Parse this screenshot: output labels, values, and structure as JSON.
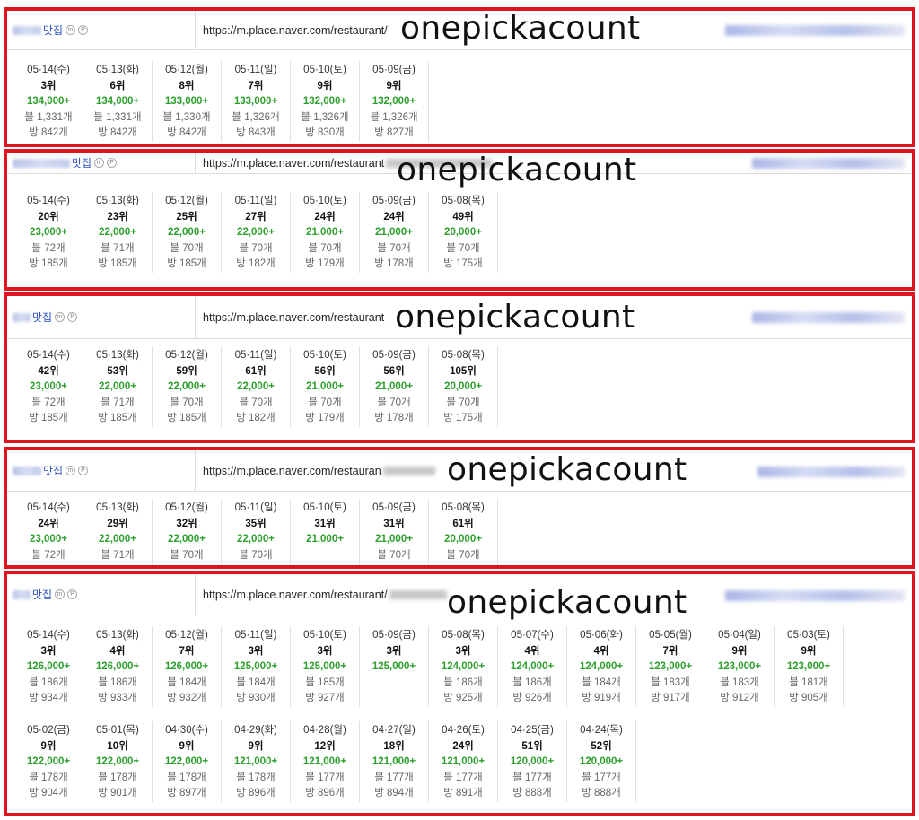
{
  "watermark": "onepickacount",
  "panels": [
    {
      "name_suffix": "맛집",
      "url": "https://m.place.naver.com/restaurant/",
      "rows": [
        [
          {
            "date": "05·14(수)",
            "rank": "3위",
            "saves": "134,000+",
            "blog": "블 1,331개",
            "visit": "방 842개"
          },
          {
            "date": "05·13(화)",
            "rank": "6위",
            "saves": "134,000+",
            "blog": "블 1,331개",
            "visit": "방 842개"
          },
          {
            "date": "05·12(월)",
            "rank": "8위",
            "saves": "133,000+",
            "blog": "블 1,330개",
            "visit": "방 842개"
          },
          {
            "date": "05·11(일)",
            "rank": "7위",
            "saves": "133,000+",
            "blog": "블 1,326개",
            "visit": "방 843개"
          },
          {
            "date": "05·10(토)",
            "rank": "9위",
            "saves": "132,000+",
            "blog": "블 1,326개",
            "visit": "방 830개"
          },
          {
            "date": "05·09(금)",
            "rank": "9위",
            "saves": "132,000+",
            "blog": "블 1,326개",
            "visit": "방 827개"
          }
        ]
      ]
    },
    {
      "name_suffix": "맛집",
      "url": "https://m.place.naver.com/restaurant",
      "rows": [
        [
          {
            "date": "05·14(수)",
            "rank": "20위",
            "saves": "23,000+",
            "blog": "블 72개",
            "visit": "방 185개"
          },
          {
            "date": "05·13(화)",
            "rank": "23위",
            "saves": "22,000+",
            "blog": "블 71개",
            "visit": "방 185개"
          },
          {
            "date": "05·12(월)",
            "rank": "25위",
            "saves": "22,000+",
            "blog": "블 70개",
            "visit": "방 185개"
          },
          {
            "date": "05·11(일)",
            "rank": "27위",
            "saves": "22,000+",
            "blog": "블 70개",
            "visit": "방 182개"
          },
          {
            "date": "05·10(토)",
            "rank": "24위",
            "saves": "21,000+",
            "blog": "블 70개",
            "visit": "방 179개"
          },
          {
            "date": "05·09(금)",
            "rank": "24위",
            "saves": "21,000+",
            "blog": "블 70개",
            "visit": "방 178개"
          },
          {
            "date": "05·08(목)",
            "rank": "49위",
            "saves": "20,000+",
            "blog": "블 70개",
            "visit": "방 175개"
          }
        ]
      ]
    },
    {
      "name_suffix": "맛집",
      "url": "https://m.place.naver.com/restaurant",
      "rows": [
        [
          {
            "date": "05·14(수)",
            "rank": "42위",
            "saves": "23,000+",
            "blog": "블 72개",
            "visit": "방 185개"
          },
          {
            "date": "05·13(화)",
            "rank": "53위",
            "saves": "22,000+",
            "blog": "블 71개",
            "visit": "방 185개"
          },
          {
            "date": "05·12(월)",
            "rank": "59위",
            "saves": "22,000+",
            "blog": "블 70개",
            "visit": "방 185개"
          },
          {
            "date": "05·11(일)",
            "rank": "61위",
            "saves": "22,000+",
            "blog": "블 70개",
            "visit": "방 182개"
          },
          {
            "date": "05·10(토)",
            "rank": "56위",
            "saves": "21,000+",
            "blog": "블 70개",
            "visit": "방 179개"
          },
          {
            "date": "05·09(금)",
            "rank": "56위",
            "saves": "21,000+",
            "blog": "블 70개",
            "visit": "방 178개"
          },
          {
            "date": "05·08(목)",
            "rank": "105위",
            "saves": "20,000+",
            "blog": "블 70개",
            "visit": "방 175개"
          }
        ]
      ]
    },
    {
      "name_suffix": "맛집",
      "url": "https://m.place.naver.com/restauran",
      "rows": [
        [
          {
            "date": "05·14(수)",
            "rank": "24위",
            "saves": "23,000+",
            "blog": "블 72개",
            "visit": ""
          },
          {
            "date": "05·13(화)",
            "rank": "29위",
            "saves": "22,000+",
            "blog": "블 71개",
            "visit": ""
          },
          {
            "date": "05·12(월)",
            "rank": "32위",
            "saves": "22,000+",
            "blog": "블 70개",
            "visit": ""
          },
          {
            "date": "05·11(일)",
            "rank": "35위",
            "saves": "22,000+",
            "blog": "블 70개",
            "visit": ""
          },
          {
            "date": "05·10(토)",
            "rank": "31위",
            "saves": "21,000+",
            "blog": "",
            "visit": ""
          },
          {
            "date": "05·09(금)",
            "rank": "31위",
            "saves": "21,000+",
            "blog": "블 70개",
            "visit": ""
          },
          {
            "date": "05·08(목)",
            "rank": "61위",
            "saves": "20,000+",
            "blog": "블 70개",
            "visit": ""
          }
        ]
      ]
    },
    {
      "name_suffix": "맛집",
      "url": "https://m.place.naver.com/restaurant/",
      "rows": [
        [
          {
            "date": "05·14(수)",
            "rank": "3위",
            "saves": "126,000+",
            "blog": "블 186개",
            "visit": "방 934개"
          },
          {
            "date": "05·13(화)",
            "rank": "4위",
            "saves": "126,000+",
            "blog": "블 186개",
            "visit": "방 933개"
          },
          {
            "date": "05·12(월)",
            "rank": "7위",
            "saves": "126,000+",
            "blog": "블 184개",
            "visit": "방 932개"
          },
          {
            "date": "05·11(일)",
            "rank": "3위",
            "saves": "125,000+",
            "blog": "블 184개",
            "visit": "방 930개"
          },
          {
            "date": "05·10(토)",
            "rank": "3위",
            "saves": "125,000+",
            "blog": "블 185개",
            "visit": "방 927개"
          },
          {
            "date": "05·09(금)",
            "rank": "3위",
            "saves": "125,000+",
            "blog": "",
            "visit": ""
          },
          {
            "date": "05·08(목)",
            "rank": "3위",
            "saves": "124,000+",
            "blog": "블 186개",
            "visit": "방 925개"
          },
          {
            "date": "05·07(수)",
            "rank": "4위",
            "saves": "124,000+",
            "blog": "블 186개",
            "visit": "방 926개"
          },
          {
            "date": "05·06(화)",
            "rank": "4위",
            "saves": "124,000+",
            "blog": "블 184개",
            "visit": "방 919개"
          },
          {
            "date": "05·05(월)",
            "rank": "7위",
            "saves": "123,000+",
            "blog": "블 183개",
            "visit": "방 917개"
          },
          {
            "date": "05·04(일)",
            "rank": "9위",
            "saves": "123,000+",
            "blog": "블 183개",
            "visit": "방 912개"
          },
          {
            "date": "05·03(토)",
            "rank": "9위",
            "saves": "123,000+",
            "blog": "블 181개",
            "visit": "방 905개"
          }
        ],
        [
          {
            "date": "05·02(금)",
            "rank": "9위",
            "saves": "122,000+",
            "blog": "블 178개",
            "visit": "방 904개"
          },
          {
            "date": "05·01(목)",
            "rank": "10위",
            "saves": "122,000+",
            "blog": "블 178개",
            "visit": "방 901개"
          },
          {
            "date": "04·30(수)",
            "rank": "9위",
            "saves": "122,000+",
            "blog": "블 178개",
            "visit": "방 897개"
          },
          {
            "date": "04·29(화)",
            "rank": "9위",
            "saves": "121,000+",
            "blog": "블 178개",
            "visit": "방 896개"
          },
          {
            "date": "04·28(월)",
            "rank": "12위",
            "saves": "121,000+",
            "blog": "블 177개",
            "visit": "방 896개"
          },
          {
            "date": "04·27(일)",
            "rank": "18위",
            "saves": "121,000+",
            "blog": "블 177개",
            "visit": "방 894개"
          },
          {
            "date": "04·26(토)",
            "rank": "24위",
            "saves": "121,000+",
            "blog": "블 177개",
            "visit": "방 891개"
          },
          {
            "date": "04·25(금)",
            "rank": "51위",
            "saves": "120,000+",
            "blog": "블 177개",
            "visit": "방 888개"
          },
          {
            "date": "04·24(목)",
            "rank": "52위",
            "saves": "120,000+",
            "blog": "블 177개",
            "visit": "방 888개"
          }
        ]
      ]
    }
  ],
  "colors": {
    "border": "#e0141e",
    "saves": "#2ea02e",
    "name": "#2a4fc6"
  }
}
